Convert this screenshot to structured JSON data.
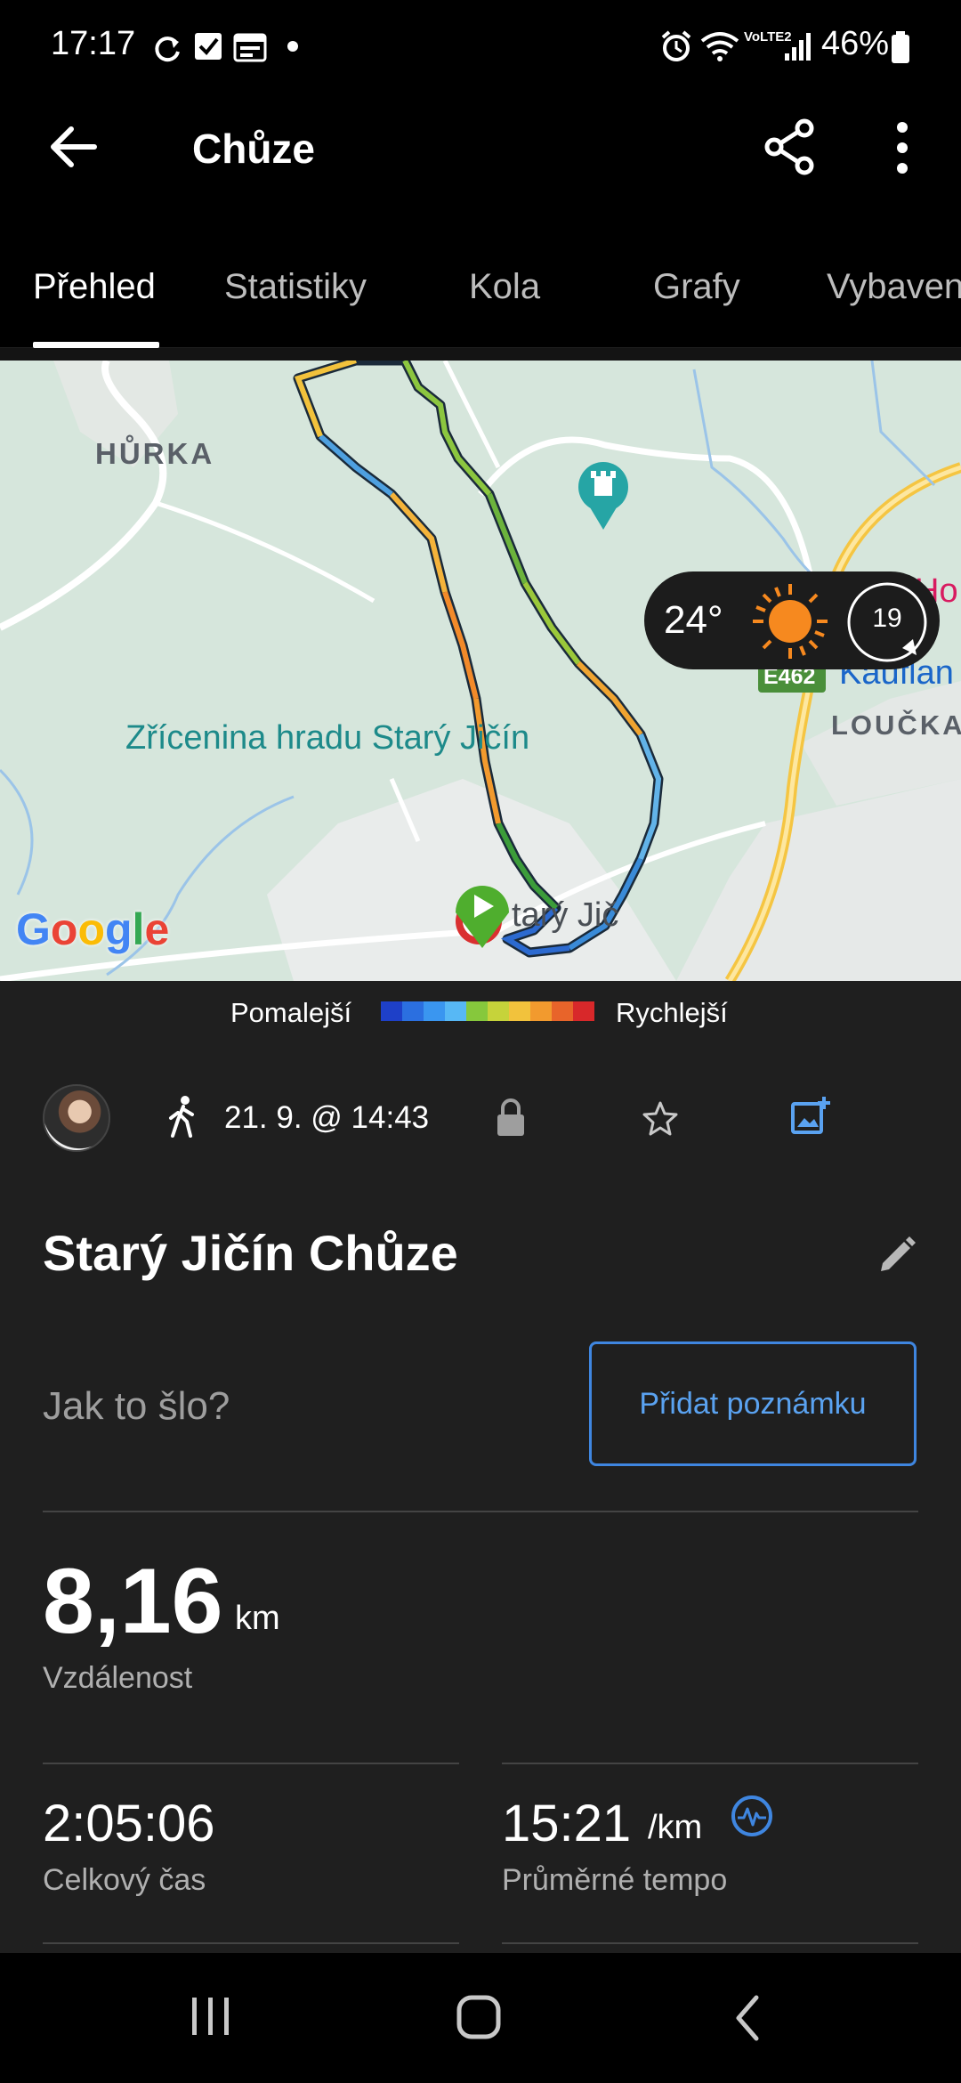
{
  "status_bar": {
    "time": "17:17",
    "battery": "46%",
    "network": "VoLTE2"
  },
  "app_bar": {
    "title": "Chůze",
    "icons": [
      "back-arrow-icon",
      "share-icon",
      "more-vert-icon"
    ]
  },
  "tabs": [
    {
      "label": "Přehled",
      "active": true
    },
    {
      "label": "Statistiky",
      "active": false
    },
    {
      "label": "Kola",
      "active": false
    },
    {
      "label": "Grafy",
      "active": false
    },
    {
      "label": "Vybaven",
      "active": false
    }
  ],
  "map": {
    "labels": {
      "hurka": "HŮRKA",
      "castle": "Zřícenina hradu Starý Jičín",
      "town": "tarý Jič",
      "loucka": "LOUČKA",
      "kaufland": "Kauflan",
      "ho": "Ho",
      "road": "E462",
      "google": "Google"
    },
    "weather": {
      "temperature": "24°",
      "wind": "19",
      "icon": "sun-icon"
    }
  },
  "legend": {
    "slower": "Pomalejší",
    "faster": "Rychlejší",
    "colors": [
      "#1e40c8",
      "#2b6fe0",
      "#3a96f0",
      "#57b8f5",
      "#86c83c",
      "#c6d33a",
      "#f2c23c",
      "#f29a2e",
      "#e8642a",
      "#d8282a"
    ]
  },
  "activity": {
    "datetime": "21. 9. @ 14:43",
    "title": "Starý Jičín Chůze",
    "question_placeholder": "Jak to šlo?",
    "note_button": "Přidat poznámku"
  },
  "stats": {
    "distance": {
      "value": "8,16",
      "unit": "km",
      "label": "Vzdálenost"
    },
    "total_time": {
      "value": "2:05:06",
      "label": "Celkový čas"
    },
    "avg_pace": {
      "value": "15:21",
      "unit": "/km",
      "label": "Průměrné tempo"
    }
  }
}
